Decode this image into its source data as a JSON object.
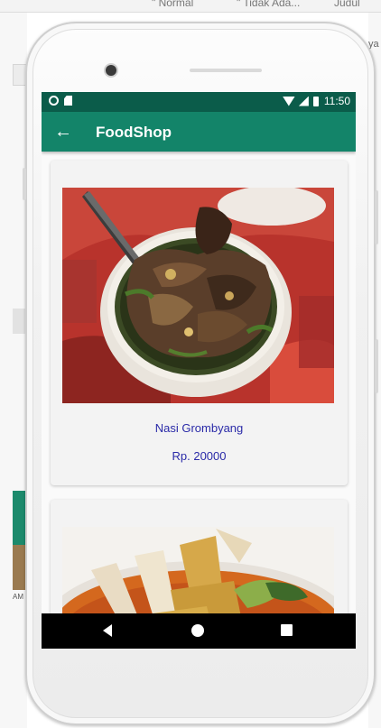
{
  "background": {
    "text_items": [
      "\" Normal",
      "\" Tidak Ada...",
      "Judul"
    ],
    "right_fragment": "ya",
    "left_caption": "AM"
  },
  "status_bar": {
    "time": "11:50"
  },
  "app_bar": {
    "title": "FoodShop",
    "back_icon": "arrow-back-icon"
  },
  "products": [
    {
      "name": "Nasi Grombyang",
      "price": "Rp. 20000"
    },
    {
      "name": "",
      "price": ""
    }
  ],
  "colors": {
    "status_bar": "#0b5c4a",
    "app_bar": "#138469",
    "text_accent": "#2a2aa8",
    "card_bg": "#f3f3f3"
  }
}
